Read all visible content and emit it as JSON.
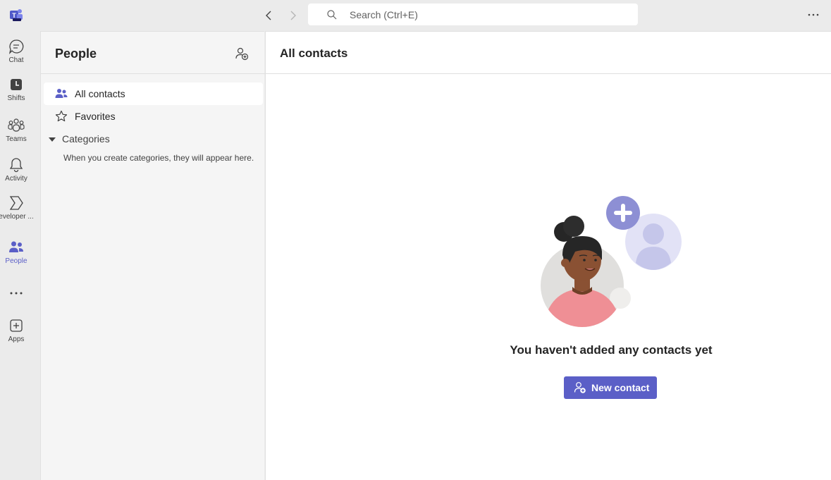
{
  "titlebar": {
    "logo_icon": "teams-logo-icon",
    "search_placeholder": "Search (Ctrl+E)"
  },
  "rail": {
    "items": [
      {
        "label": "Chat",
        "icon": "chat-icon"
      },
      {
        "label": "Shifts",
        "icon": "shifts-icon"
      },
      {
        "label": "Teams",
        "icon": "teams-icon"
      },
      {
        "label": "Activity",
        "icon": "bell-icon"
      },
      {
        "label": "eveloper ...",
        "icon": "developer-portal-icon"
      },
      {
        "label": "People",
        "icon": "people-icon",
        "active": true
      },
      {
        "label": "Apps",
        "icon": "apps-icon"
      }
    ]
  },
  "panel": {
    "title": "People",
    "nav": [
      {
        "label": "All contacts",
        "icon": "people-icon",
        "selected": true
      },
      {
        "label": "Favorites",
        "icon": "star-icon",
        "selected": false
      }
    ],
    "categories": {
      "label": "Categories",
      "hint": "When you create categories, they will appear here."
    }
  },
  "main": {
    "title": "All contacts",
    "empty_message": "You haven't added any contacts yet",
    "new_contact_label": "New contact"
  },
  "colors": {
    "accent": "#5b5fc7",
    "rail_bg": "#ebebeb",
    "panel_bg": "#f5f5f5"
  }
}
